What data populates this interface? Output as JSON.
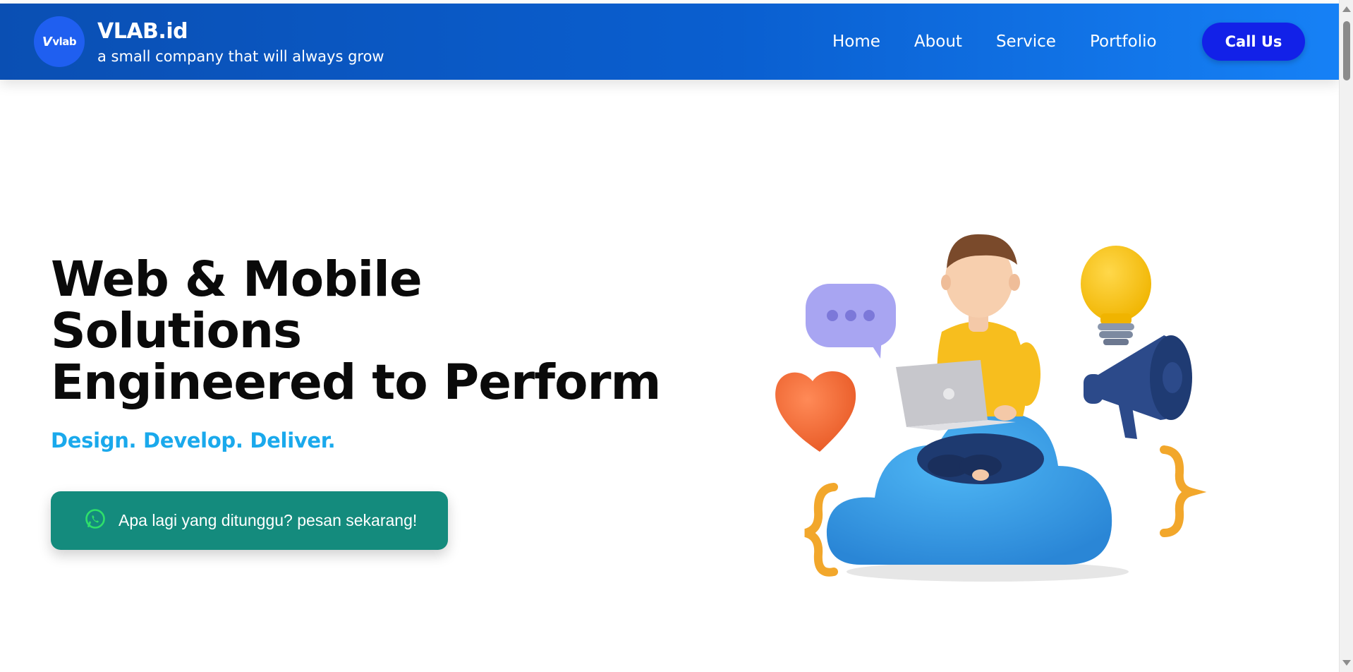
{
  "navbar": {
    "logo_text": "vlab",
    "brand_title": "VLAB.id",
    "brand_tagline": "a small company that will always grow",
    "links": [
      {
        "label": "Home"
      },
      {
        "label": "About"
      },
      {
        "label": "Service"
      },
      {
        "label": "Portfolio"
      }
    ],
    "call_button": "Call Us"
  },
  "hero": {
    "title_lines": [
      "Web & Mobile",
      "Solutions",
      "Engineered to Perform"
    ],
    "subtitle": "Design. Develop. Deliver.",
    "cta_label": "Apa lagi yang ditunggu? pesan sekarang!",
    "cta_icon": "whatsapp-icon"
  },
  "illustration": {
    "icons": [
      "chat-bubble-icon",
      "lightbulb-icon",
      "heart-icon",
      "megaphone-icon",
      "cloud-icon",
      "laptop-icon",
      "curly-braces-icon"
    ]
  },
  "colors": {
    "navbar_start": "#0a4fb3",
    "navbar_end": "#1681f6",
    "call_button": "#1221e8",
    "subtitle": "#1aa9ec",
    "cta_button": "#148b7d"
  }
}
